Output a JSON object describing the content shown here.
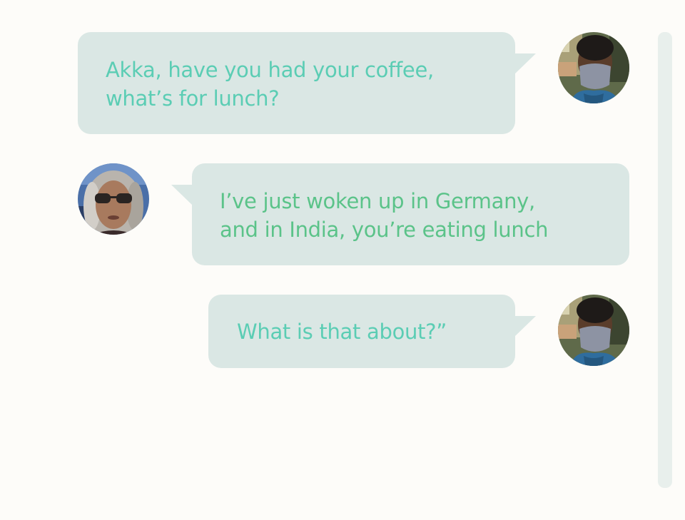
{
  "messages": [
    {
      "side": "right",
      "sender_avatar": "masked-person-avatar",
      "text": "Akka, have you had your coffee,\nwhat’s for lunch?",
      "color": "#5bcdb4"
    },
    {
      "side": "left",
      "sender_avatar": "sunglasses-person-avatar",
      "text": "I’ve just woken up in Germany,\nand in India, you’re eating lunch",
      "color": "#5bc389"
    },
    {
      "side": "right",
      "sender_avatar": "masked-person-avatar",
      "text": "What is that about?”",
      "color": "#5bcdb4"
    }
  ],
  "colors": {
    "background": "#fdfcf9",
    "bubble": "#dae7e4",
    "scrollbar": "#e8efec"
  }
}
